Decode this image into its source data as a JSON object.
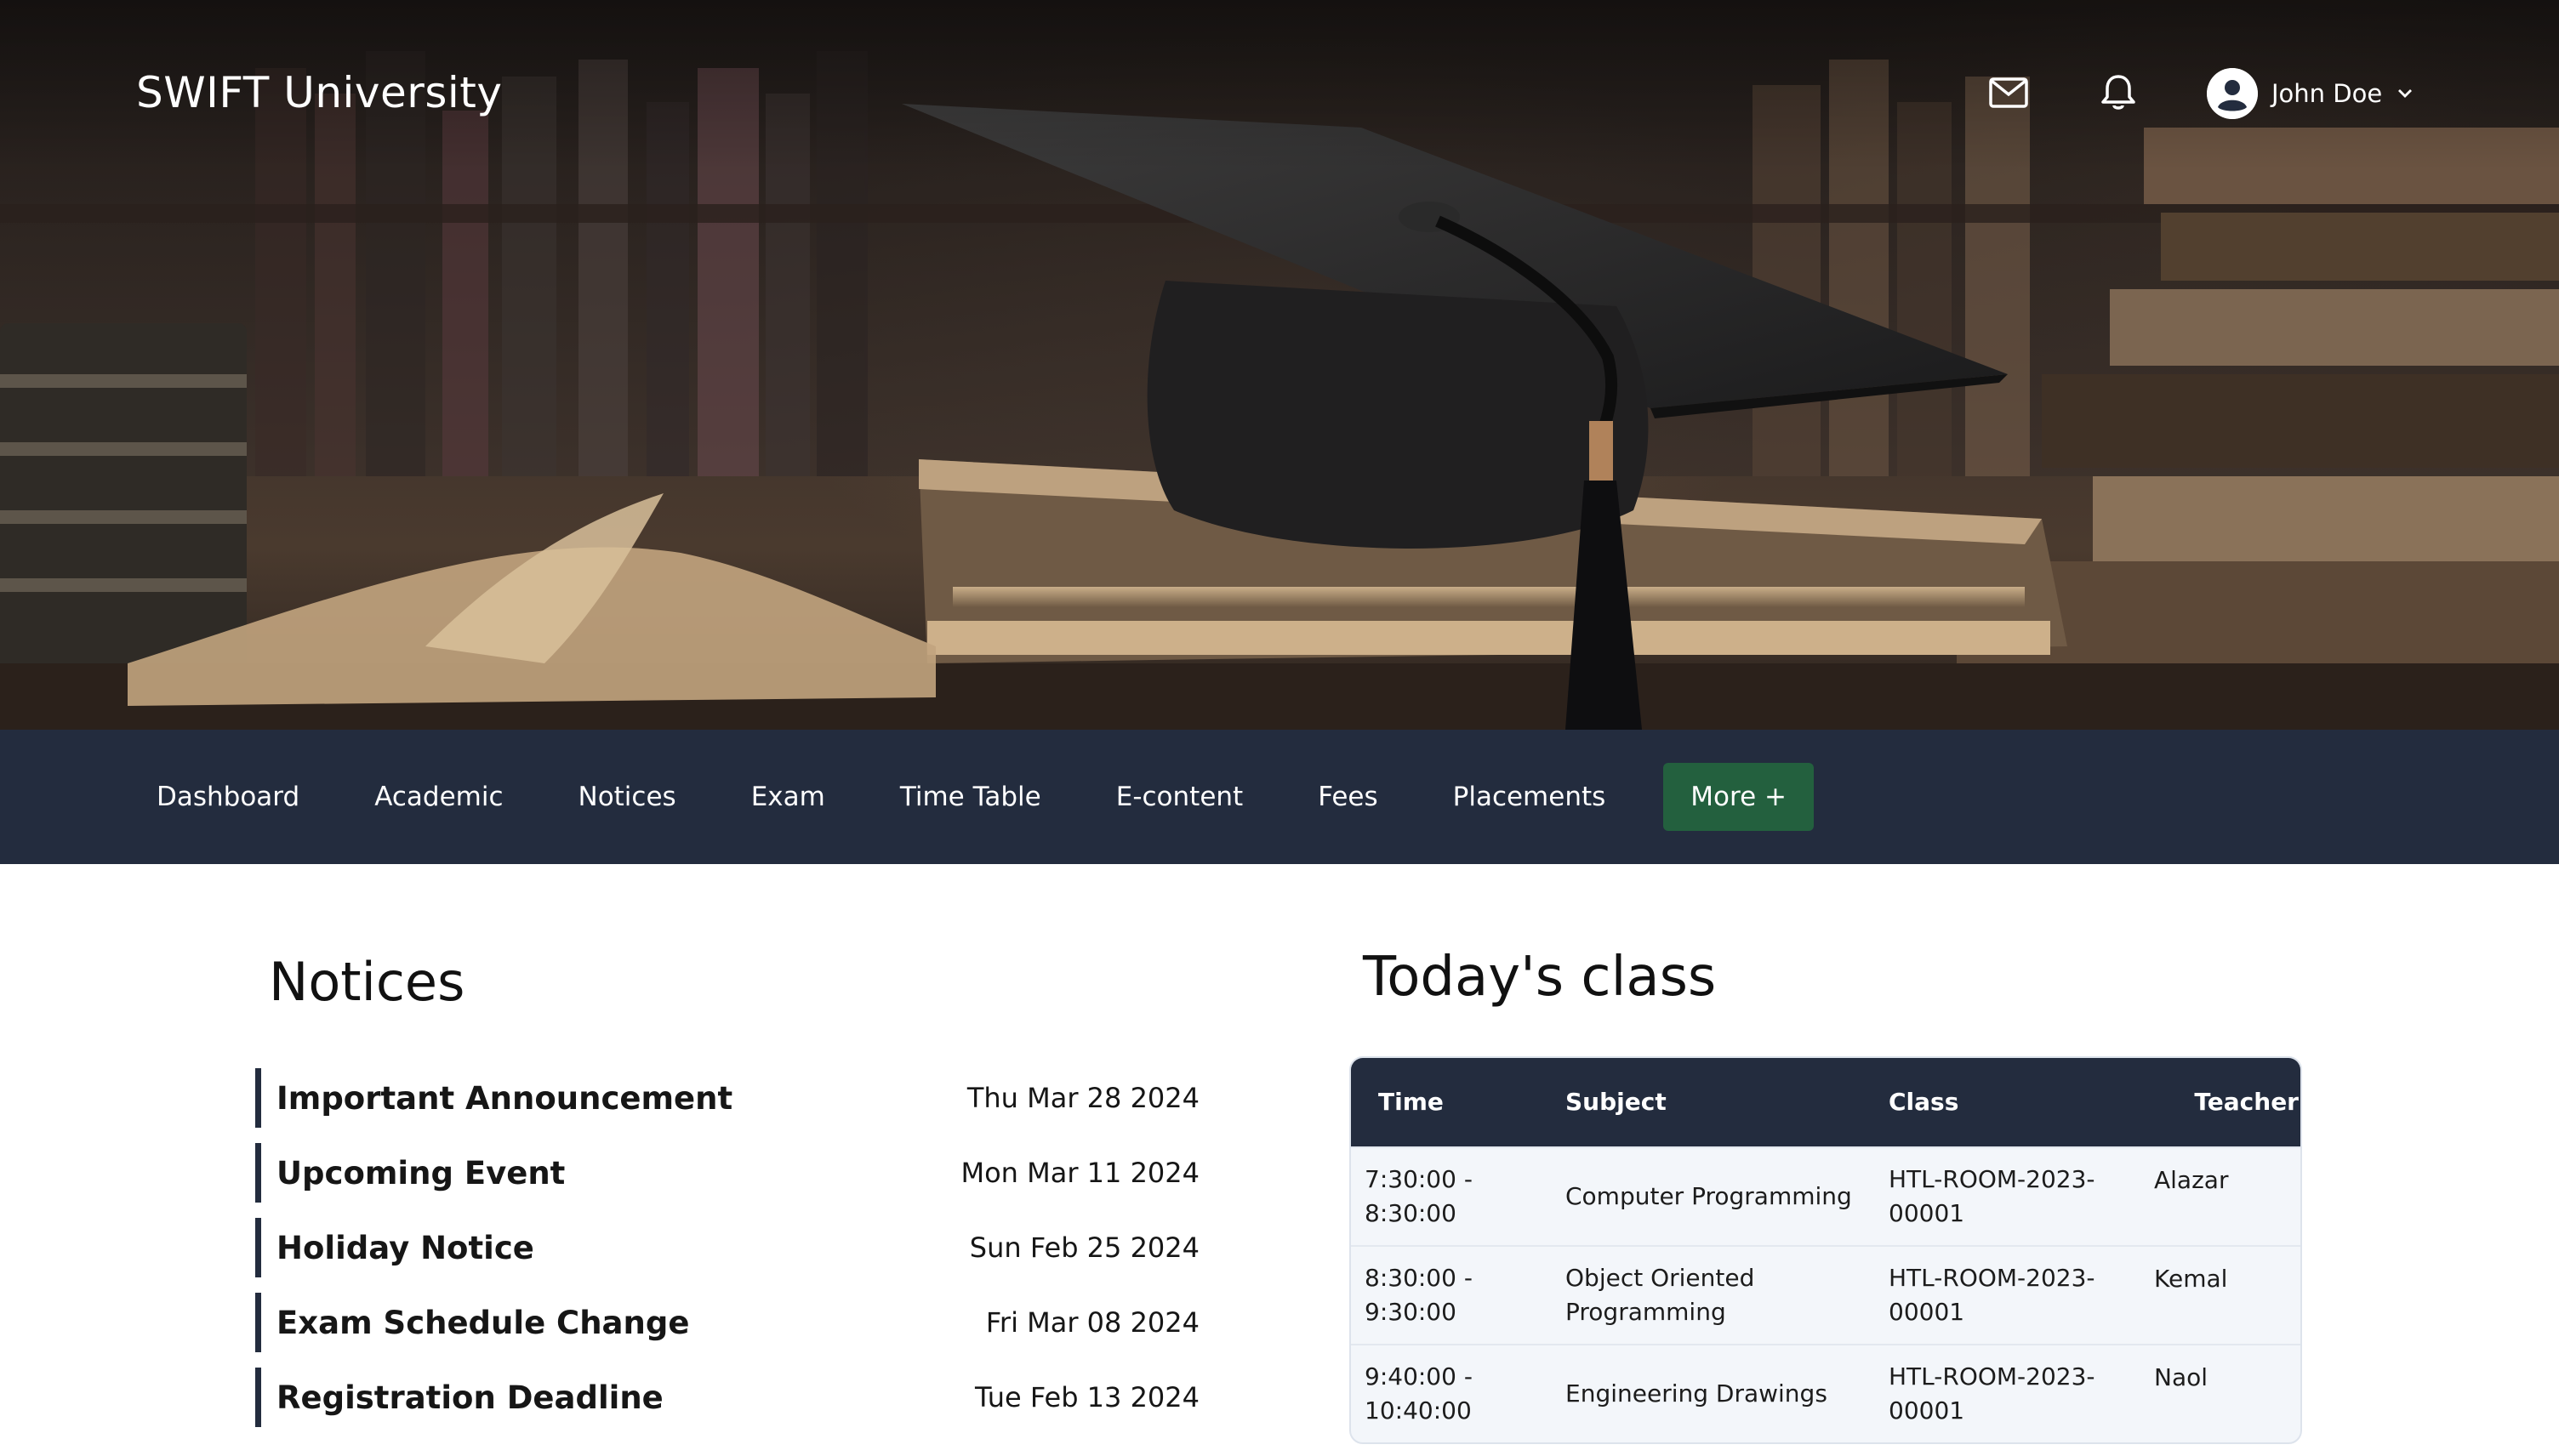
{
  "header": {
    "brand": "SWIFT University",
    "user": {
      "name": "John Doe"
    },
    "icons": [
      "mail-icon",
      "bell-icon",
      "user-avatar-icon",
      "chevron-down-icon"
    ]
  },
  "nav": {
    "items": [
      {
        "label": "Dashboard"
      },
      {
        "label": "Academic"
      },
      {
        "label": "Notices"
      },
      {
        "label": "Exam"
      },
      {
        "label": "Time Table"
      },
      {
        "label": "E-content"
      },
      {
        "label": "Fees"
      },
      {
        "label": "Placements"
      }
    ],
    "more_label": "More +",
    "more_color": "#23603e",
    "background": "#232c3e"
  },
  "notices": {
    "title": "Notices",
    "items": [
      {
        "title": "Important Announcement",
        "date": "Thu Mar 28 2024"
      },
      {
        "title": "Upcoming Event",
        "date": "Mon Mar 11 2024"
      },
      {
        "title": "Holiday Notice",
        "date": "Sun Feb 25 2024"
      },
      {
        "title": "Exam Schedule Change",
        "date": "Fri Mar 08 2024"
      },
      {
        "title": "Registration Deadline",
        "date": "Tue Feb 13 2024"
      }
    ]
  },
  "todays_class": {
    "title": "Today's class",
    "columns": [
      "Time",
      "Subject",
      "Class",
      "Teacher"
    ],
    "rows": [
      {
        "time": [
          "7:30:00 -",
          "8:30:00"
        ],
        "subject": [
          "Computer Programming"
        ],
        "class": [
          "HTL-ROOM-2023-",
          "00001"
        ],
        "teacher": "Alazar"
      },
      {
        "time": [
          "8:30:00 -",
          "9:30:00"
        ],
        "subject": [
          "Object Oriented",
          "Programming"
        ],
        "class": [
          "HTL-ROOM-2023-",
          "00001"
        ],
        "teacher": "Kemal"
      },
      {
        "time": [
          "9:40:00 -",
          "10:40:00"
        ],
        "subject": [
          "Engineering Drawings"
        ],
        "class": [
          "HTL-ROOM-2023-",
          "00001"
        ],
        "teacher": "Naol"
      }
    ]
  }
}
